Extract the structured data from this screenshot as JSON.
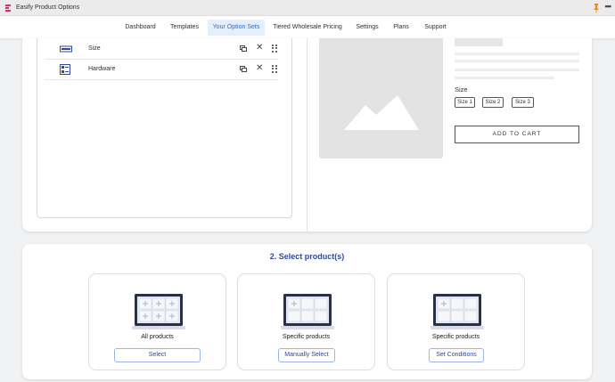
{
  "app": {
    "title": "Easify Product Options"
  },
  "nav": {
    "items": [
      {
        "label": "Dashboard"
      },
      {
        "label": "Templates"
      },
      {
        "label": "Your Option Sets"
      },
      {
        "label": "Tiered Wholesale Pricing"
      },
      {
        "label": "Settings"
      },
      {
        "label": "Plans"
      },
      {
        "label": "Support"
      }
    ],
    "active": "Your Option Sets"
  },
  "options": [
    {
      "label": "Size",
      "icon": "dropdown-field-icon"
    },
    {
      "label": "Hardware",
      "icon": "swatch-list-icon"
    }
  ],
  "preview": {
    "size_label": "Size",
    "sizes": [
      "Size 1",
      "Size 2",
      "Size 3"
    ],
    "add_to_cart": "ADD TO CART"
  },
  "select_products": {
    "title": "2. Select product(s)",
    "cards": [
      {
        "label": "All products",
        "button": "Select"
      },
      {
        "label": "Specific products",
        "button": "Manually Select"
      },
      {
        "label": "Specific products",
        "button": "Set Conditions"
      }
    ]
  },
  "colors": {
    "accent": "#2c4a9e",
    "nav_active_bg": "#e4eefc",
    "nav_active_text": "#2c6ecb"
  }
}
